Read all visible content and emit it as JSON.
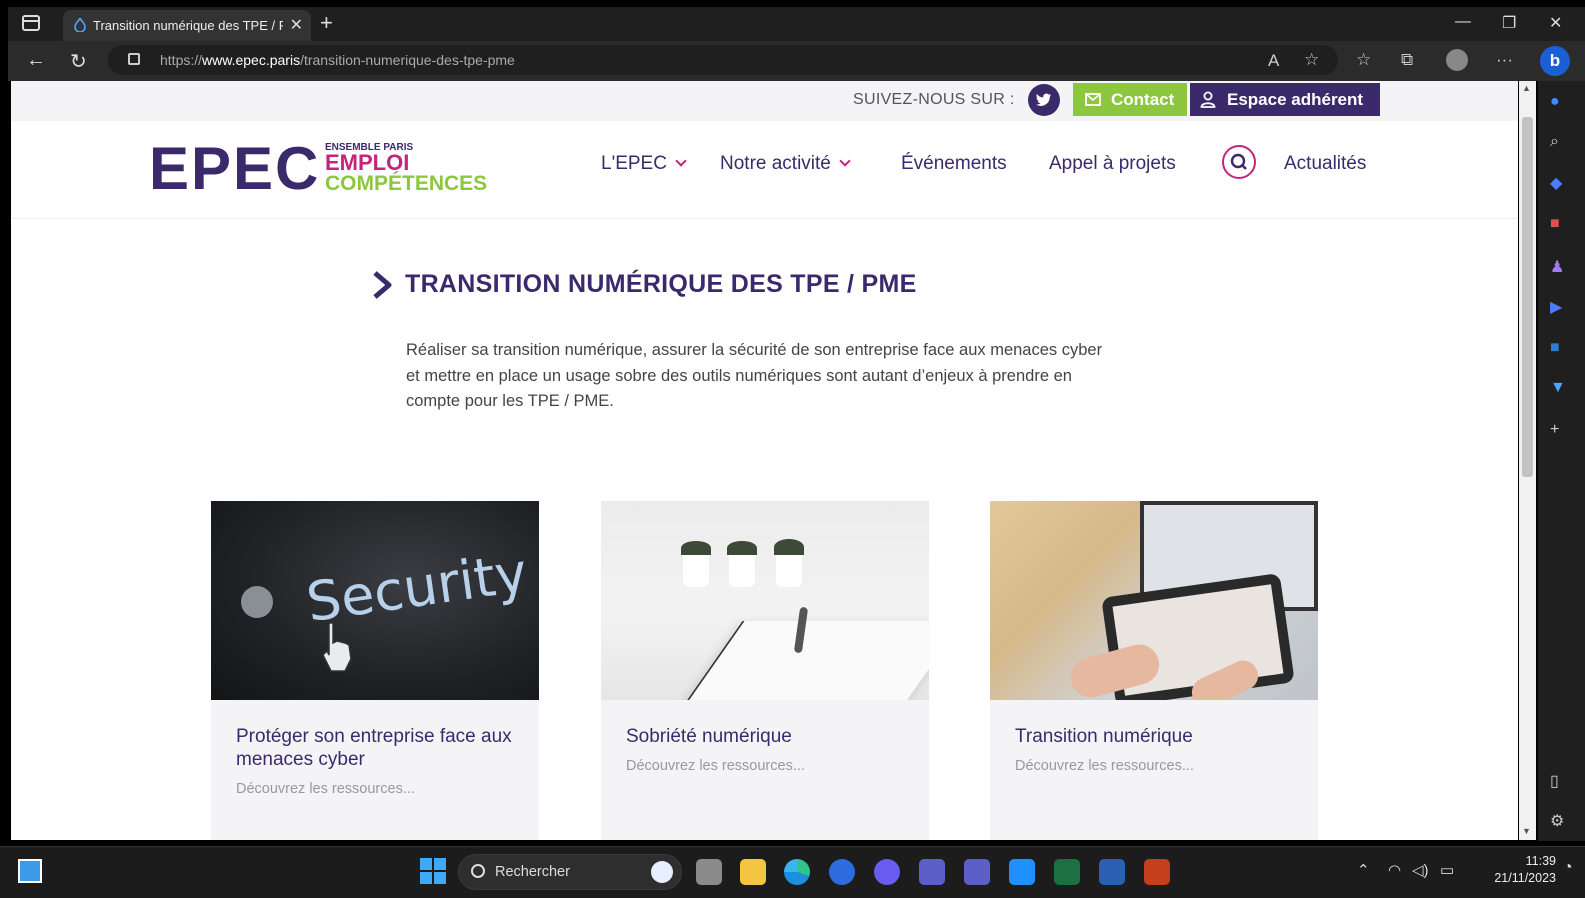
{
  "browser": {
    "tab_title": "Transition numérique des TPE / PME",
    "url_prefix": "https://",
    "url_domain": "www.epec.paris",
    "url_path": "/transition-numerique-des-tpe-pme"
  },
  "topbar": {
    "follow_label": "SUIVEZ-NOUS SUR :",
    "contact_label": "Contact",
    "espace_label": "Espace adhérent"
  },
  "logo": {
    "big": "EPEC",
    "line1": "ENSEMBLE PARIS",
    "line2": "EMPLOI",
    "line3": "COMPÉTENCES"
  },
  "nav": {
    "items": [
      {
        "label": "L'EPEC"
      },
      {
        "label": "Notre activité"
      },
      {
        "label": "Événements"
      },
      {
        "label": "Appel à projets"
      },
      {
        "label": "Actualités"
      }
    ]
  },
  "main": {
    "title": "TRANSITION NUMÉRIQUE DES TPE / PME",
    "intro": "Réaliser sa transition numérique, assurer la sécurité de son entreprise face aux menaces cyber et mettre en place un usage sobre des outils numériques sont autant d’enjeux à prendre en compte pour les TPE / PME.",
    "cards": [
      {
        "title": "Protéger son entreprise face aux menaces cyber",
        "subtitle": "Découvrez les ressources...",
        "image_word": "Security"
      },
      {
        "title": "Sobriété numérique",
        "subtitle": "Découvrez les ressources..."
      },
      {
        "title": "Transition numérique",
        "subtitle": "Découvrez les ressources..."
      }
    ]
  },
  "taskbar": {
    "search_placeholder": "Rechercher",
    "time": "11:39",
    "date": "21/11/2023"
  },
  "colors": {
    "brand_purple": "#3b2a6b",
    "brand_magenta": "#c4247d",
    "brand_green": "#8dc63f"
  }
}
